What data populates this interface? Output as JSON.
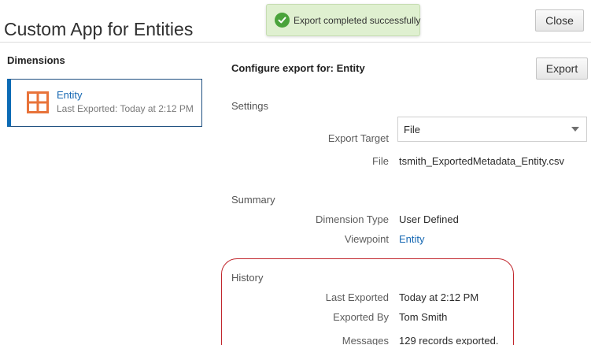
{
  "app": {
    "title": "Custom App for Entities",
    "close_label": "Close"
  },
  "toast": {
    "message": "Export completed successfully",
    "icon": "checkmark-circle-icon",
    "color": "#4aa33b"
  },
  "dimensions": {
    "heading": "Dimensions",
    "items": [
      {
        "name": "Entity",
        "subtitle": "Last Exported: Today at 2:12 PM",
        "icon": "grid-icon",
        "icon_color": "#e8733a"
      }
    ]
  },
  "config": {
    "heading": "Configure export for: Entity",
    "export_label": "Export",
    "settings": {
      "heading": "Settings",
      "export_target_label": "Export Target",
      "export_target_value": "File",
      "file_label": "File",
      "file_value": "tsmith_ExportedMetadata_Entity.csv"
    },
    "summary": {
      "heading": "Summary",
      "dimension_type_label": "Dimension Type",
      "dimension_type_value": "User Defined",
      "viewpoint_label": "Viewpoint",
      "viewpoint_value": "Entity"
    },
    "history": {
      "heading": "History",
      "last_exported_label": "Last Exported",
      "last_exported_value": "Today at 2:12 PM",
      "exported_by_label": "Exported By",
      "exported_by_value": "Tom Smith",
      "messages_label": "Messages",
      "messages_value": "129 records exported."
    }
  },
  "colors": {
    "accent": "#0b6bb5",
    "link": "#1668b3",
    "highlight": "#c1272d"
  }
}
